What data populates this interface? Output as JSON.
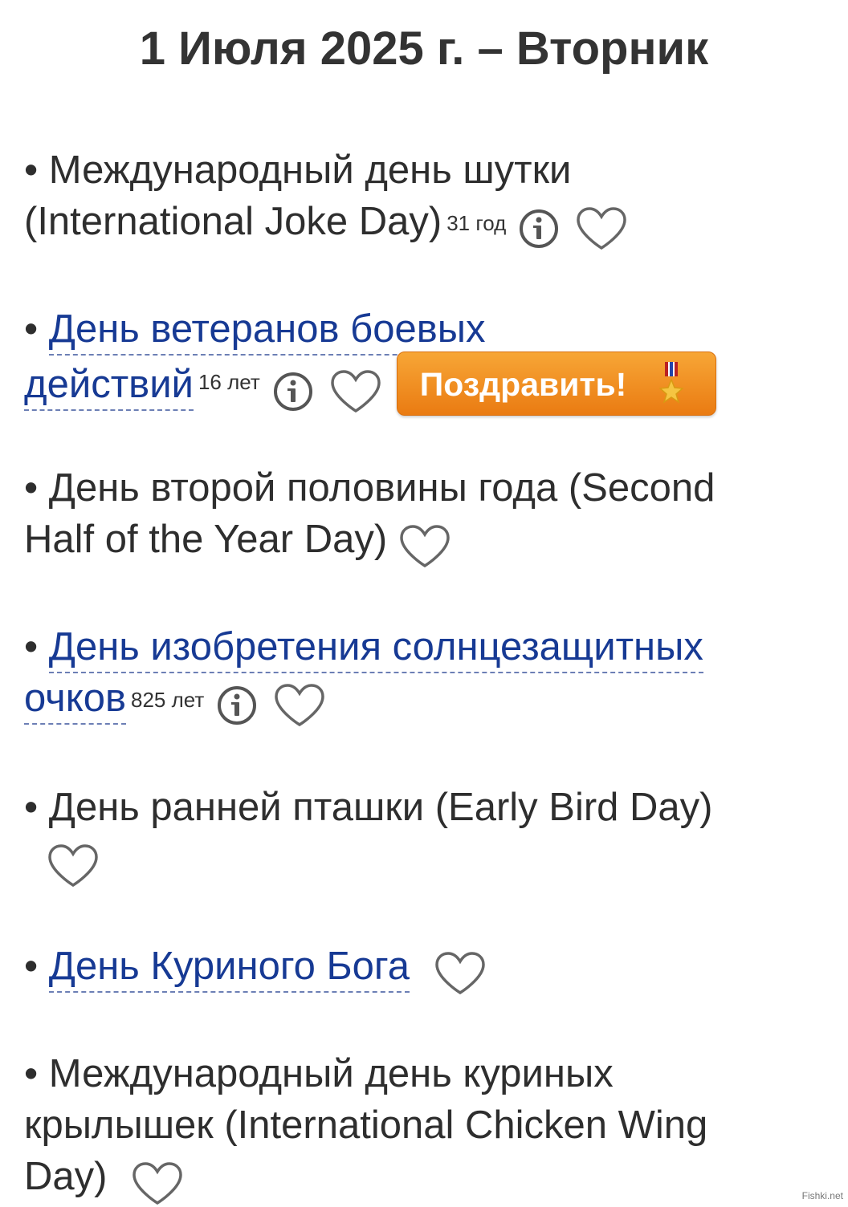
{
  "header": {
    "date_title": "1 Июля 2025 г. – Вторник"
  },
  "bullet": "•",
  "holidays": [
    {
      "line1": "Международный день шутки",
      "line2": "(International Joke Day)",
      "age": "31 год"
    },
    {
      "line1": "День ветеранов боевых",
      "line2": "действий",
      "age": "16 лет",
      "button_label": "Поздравить!"
    },
    {
      "line1": "День второй половины года (Second",
      "line2": "Half of the Year Day)"
    },
    {
      "line1": "День изобретения солнцезащитных",
      "line2": "очков",
      "age": "825 лет"
    },
    {
      "line1": "День ранней пташки (Early Bird Day)"
    },
    {
      "line1": "День Куриного Бога"
    },
    {
      "line1": "Международный день куриных",
      "line2": "крылышек (International Chicken Wing",
      "line3": "Day)"
    }
  ],
  "icons": {
    "info": "info-icon",
    "favorite": "heart-icon",
    "medal": "medal-icon"
  },
  "colors": {
    "link": "#173a94",
    "button": "#f08c1e",
    "icon": "#555555"
  },
  "watermark": "Fishki.net"
}
